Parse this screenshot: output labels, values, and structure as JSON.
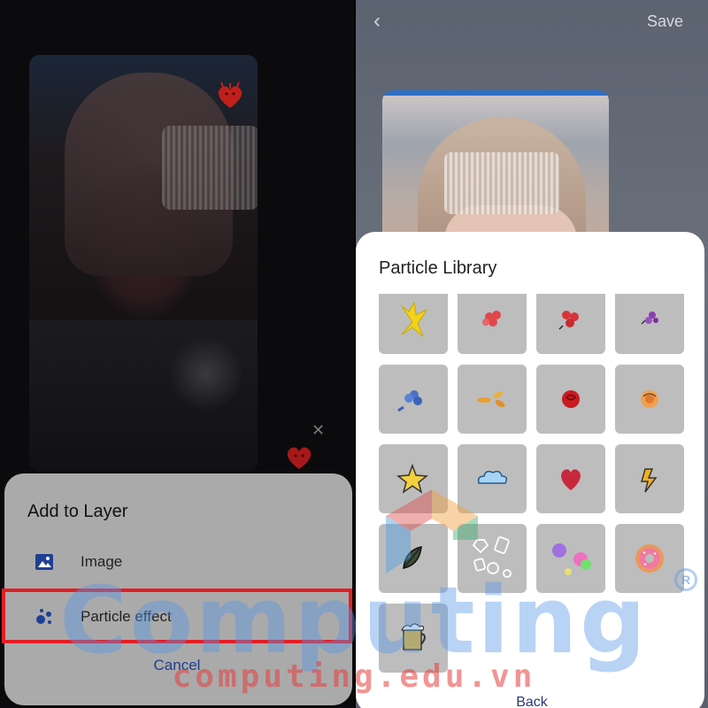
{
  "left_panel": {
    "dialog": {
      "title": "Add to Layer",
      "options": [
        {
          "label": "Image",
          "icon": "image-icon"
        },
        {
          "label": "Particle effect",
          "icon": "particle-icon"
        }
      ],
      "cancel_label": "Cancel",
      "highlighted_option": "Particle effect",
      "highlight_color": "#e41e24",
      "accent_color": "#1f3f93"
    }
  },
  "right_panel": {
    "header": {
      "back_icon": "chevron-left-icon",
      "save_label": "Save"
    },
    "library": {
      "title": "Particle Library",
      "items": [
        {
          "name": "yellow-butterfly-particle"
        },
        {
          "name": "red-flower-particle"
        },
        {
          "name": "red-flower-cluster-particle"
        },
        {
          "name": "purple-flower-particle"
        },
        {
          "name": "blue-flower-particle"
        },
        {
          "name": "orange-leaves-particle"
        },
        {
          "name": "red-rose-particle"
        },
        {
          "name": "orange-rose-particle"
        },
        {
          "name": "yellow-star-particle"
        },
        {
          "name": "blue-cloud-particle"
        },
        {
          "name": "red-heart-particle"
        },
        {
          "name": "yellow-lightning-particle"
        },
        {
          "name": "leaf-particle"
        },
        {
          "name": "white-shapes-particle"
        },
        {
          "name": "colorful-blobs-particle"
        },
        {
          "name": "donut-particle"
        },
        {
          "name": "beer-particle"
        }
      ],
      "back_label": "Back"
    }
  },
  "watermark": {
    "main_text": "Computing",
    "sub_text": "computing.edu.vn",
    "registered_mark": "R"
  }
}
